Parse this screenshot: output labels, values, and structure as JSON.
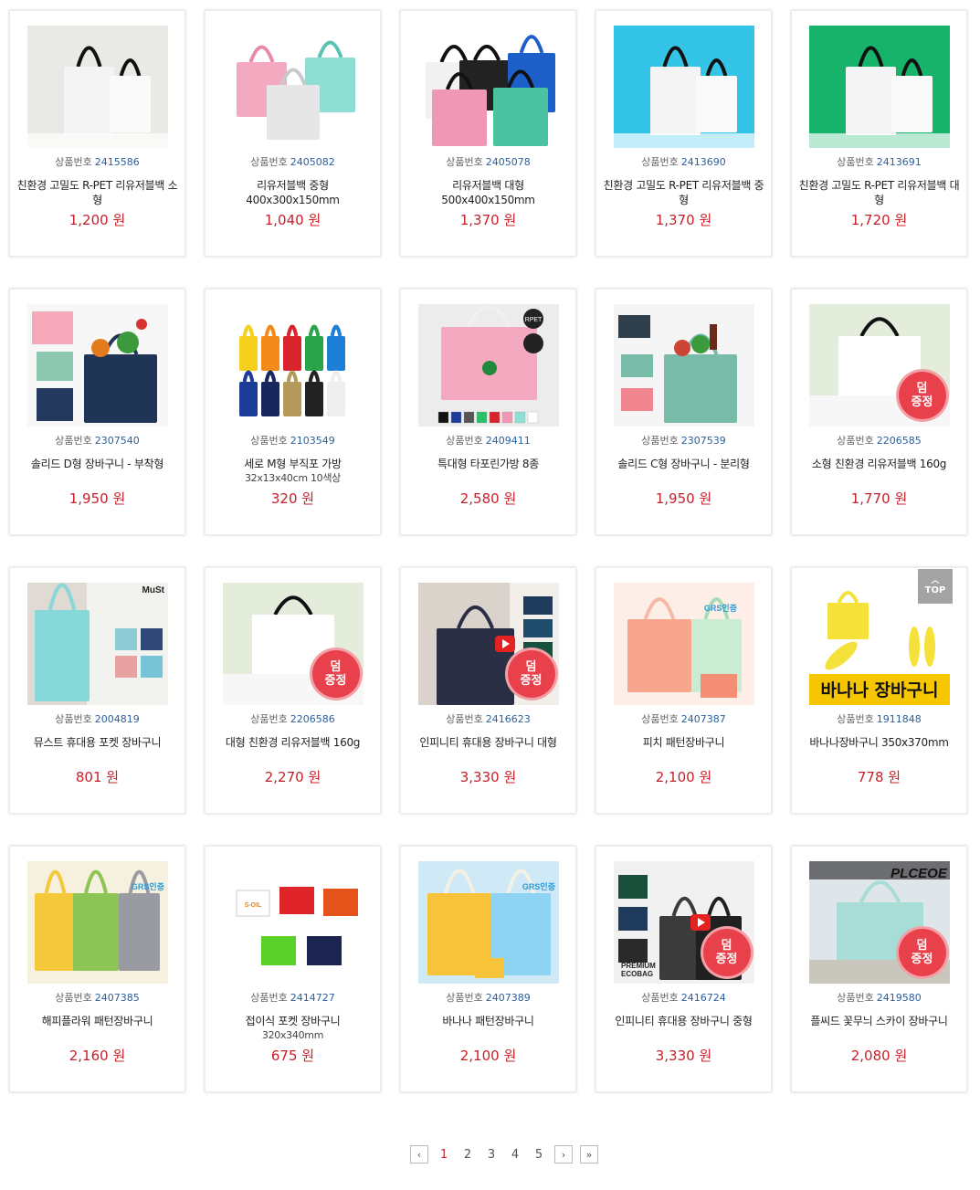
{
  "labels": {
    "product_no": "상품번호",
    "currency": "원",
    "gift_badge": [
      "덤",
      "증정"
    ],
    "top": "TOP"
  },
  "products": [
    {
      "no": "2415586",
      "name": "친환경 고밀도 R-PET 리유저블백 소형",
      "sub": "",
      "price": "1,200 원",
      "img": "rpet-white",
      "bg": "#e9e9e6",
      "badge": false,
      "play": false
    },
    {
      "no": "2405082",
      "name": "리유저블백 중형 400x300x150mm",
      "sub": "",
      "price": "1,040 원",
      "img": "pastel-bags",
      "bg": "#ffffff",
      "badge": false,
      "play": false
    },
    {
      "no": "2405078",
      "name": "리유저블백 대형 500x400x150mm",
      "sub": "",
      "price": "1,370 원",
      "img": "color-bags-large",
      "bg": "#ffffff",
      "badge": false,
      "play": false
    },
    {
      "no": "2413690",
      "name": "친환경 고밀도 R-PET 리유저블백 중형",
      "sub": "",
      "price": "1,370 원",
      "img": "rpet-blue",
      "bg": "#34c4e8",
      "badge": false,
      "play": false
    },
    {
      "no": "2413691",
      "name": "친환경 고밀도 R-PET 리유저블백 대형",
      "sub": "",
      "price": "1,720 원",
      "img": "rpet-green",
      "bg": "#17b36b",
      "badge": false,
      "play": false
    },
    {
      "no": "2307540",
      "name": "솔리드 D형 장바구니 - 부착형",
      "sub": "",
      "price": "1,950 원",
      "img": "solid-navy",
      "bg": "#f7f7f7",
      "badge": false,
      "play": false
    },
    {
      "no": "2103549",
      "name": "세로 M형 부직포 가방",
      "sub": "32x13x40cm 10색상",
      "price": "320 원",
      "img": "multicolor",
      "bg": "#ffffff",
      "badge": false,
      "play": false
    },
    {
      "no": "2409411",
      "name": "특대형 타포린가방 8종",
      "sub": "",
      "price": "2,580 원",
      "img": "tarpaulin",
      "bg": "#ececec",
      "badge": false,
      "play": false
    },
    {
      "no": "2307539",
      "name": "솔리드 C형 장바구니 - 분리형",
      "sub": "",
      "price": "1,950 원",
      "img": "solid-mint",
      "bg": "#f5f5f5",
      "badge": false,
      "play": false
    },
    {
      "no": "2206585",
      "name": "소형 친환경 리유저블백 160g",
      "sub": "",
      "price": "1,770 원",
      "img": "eco-small",
      "bg": "#e4ecdc",
      "badge": true,
      "play": false
    },
    {
      "no": "2004819",
      "name": "뮤스트 휴대용 포켓 장바구니",
      "sub": "",
      "price": "801 원",
      "img": "must-mint",
      "bg": "#f2f2ee",
      "badge": false,
      "play": false
    },
    {
      "no": "2206586",
      "name": "대형 친환경 리유저블백 160g",
      "sub": "",
      "price": "2,270 원",
      "img": "eco-large",
      "bg": "#e4ecdc",
      "badge": true,
      "play": false
    },
    {
      "no": "2416623",
      "name": "인피니티 휴대용 장바구니 대형",
      "sub": "",
      "price": "3,330 원",
      "img": "infinity-large",
      "bg": "#f2efea",
      "badge": true,
      "play": true
    },
    {
      "no": "2407387",
      "name": "피치 패턴장바구니",
      "sub": "",
      "price": "2,100 원",
      "img": "peach",
      "bg": "#fdeee8",
      "badge": false,
      "play": false
    },
    {
      "no": "1911848",
      "name": "바나나장바구니 350x370mm",
      "sub": "",
      "price": "778 원",
      "img": "banana",
      "bg": "#ffffff",
      "badge": false,
      "play": false
    },
    {
      "no": "2407385",
      "name": "해피플라워 패턴장바구니",
      "sub": "",
      "price": "2,160 원",
      "img": "flower",
      "bg": "#f6f0df",
      "badge": false,
      "play": false
    },
    {
      "no": "2414727",
      "name": "접이식 포켓 장바구니",
      "sub": "320x340mm",
      "price": "675 원",
      "img": "pocket",
      "bg": "#ffffff",
      "badge": false,
      "play": false
    },
    {
      "no": "2407389",
      "name": "바나나 패턴장바구니",
      "sub": "",
      "price": "2,100 원",
      "img": "banana-pattern",
      "bg": "#cfe9f7",
      "badge": false,
      "play": false
    },
    {
      "no": "2416724",
      "name": "인피니티 휴대용 장바구니 중형",
      "sub": "",
      "price": "3,330 원",
      "img": "infinity-medium",
      "bg": "#f1f1f1",
      "badge": true,
      "play": true
    },
    {
      "no": "2419580",
      "name": "플씨드 꽃무늬 스카이 장바구니",
      "sub": "",
      "price": "2,080 원",
      "img": "plceoe-sky",
      "bg": "#dfe6ea",
      "badge": true,
      "play": false
    }
  ],
  "image_text": {
    "musT": "MuSt",
    "banana": "바나나 장바구니",
    "grs": "GRS인증",
    "rpet": "RPET",
    "premium": "PREMIUM",
    "ecobag": "ECOBAG",
    "plceoe": "PLCEOE",
    "soil": "S-OIL"
  },
  "pagination": {
    "pages": [
      "1",
      "2",
      "3",
      "4",
      "5"
    ],
    "current": "1",
    "prev": "‹",
    "next": "›",
    "last": "»"
  }
}
